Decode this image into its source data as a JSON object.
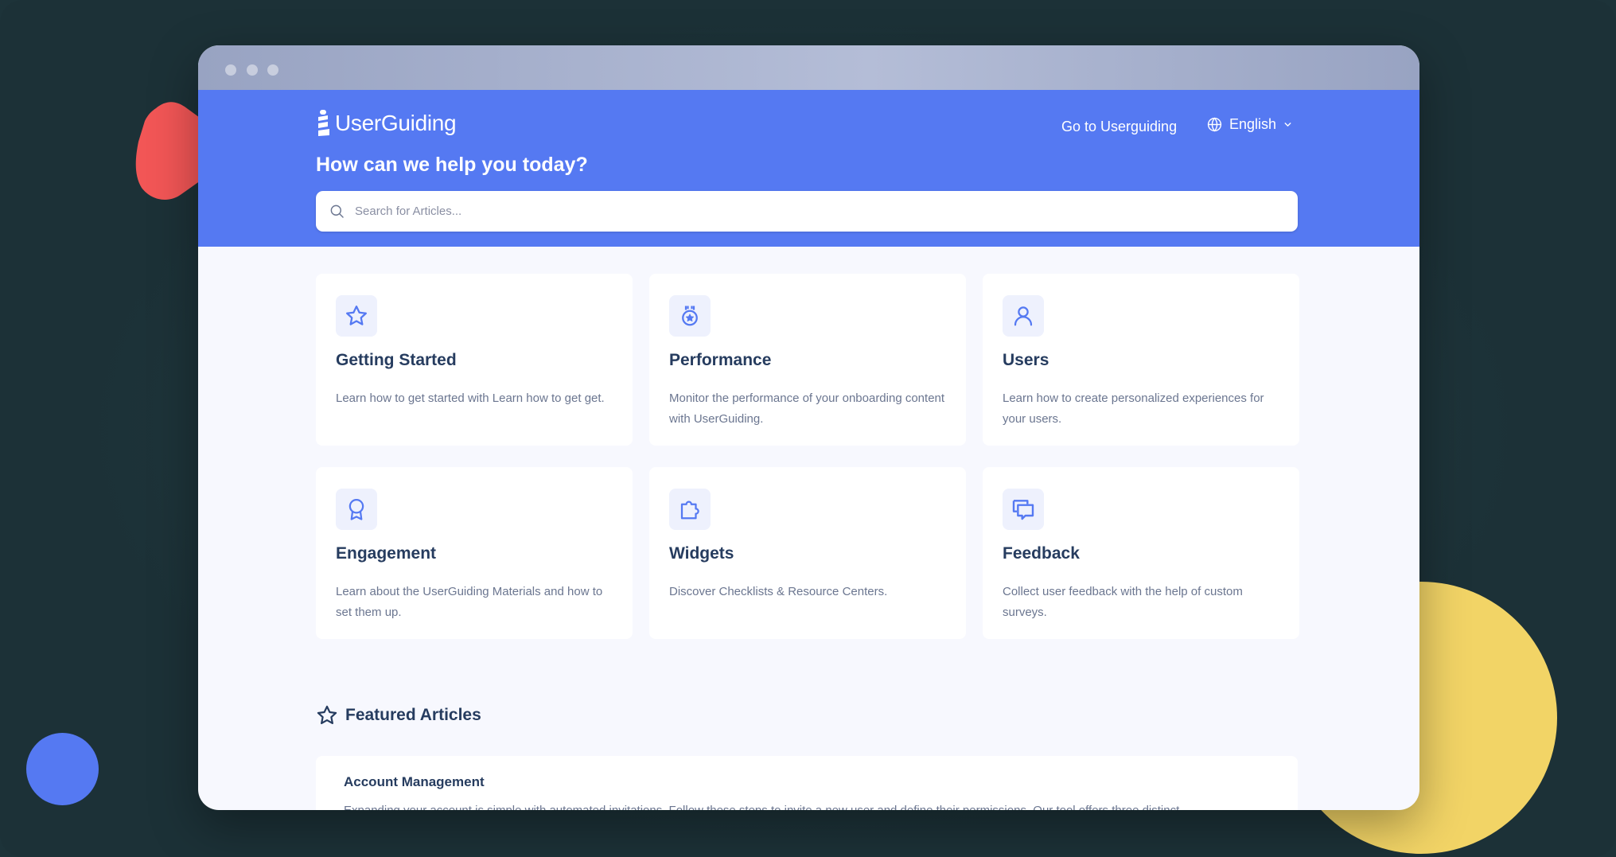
{
  "brand": {
    "logo_text": "UserGuiding",
    "primary_color": "#5579f2",
    "heading_color": "#263c5f"
  },
  "header": {
    "nav_link": "Go to Userguiding",
    "language": "English",
    "title": "How can we help you today?"
  },
  "search": {
    "placeholder": "Search for Articles..."
  },
  "categories": [
    {
      "icon": "star-icon",
      "title": "Getting Started",
      "description": "Learn how to get started with Learn how to get get."
    },
    {
      "icon": "medal-icon",
      "title": "Performance",
      "description": "Monitor the performance of your onboarding content with UserGuiding."
    },
    {
      "icon": "user-icon",
      "title": "Users",
      "description": "Learn how to create personalized experiences for your users."
    },
    {
      "icon": "award-ribbon-icon",
      "title": "Engagement",
      "description": "Learn about the UserGuiding Materials and how to set them up."
    },
    {
      "icon": "puzzle-icon",
      "title": "Widgets",
      "description": "Discover Checklists & Resource Centers."
    },
    {
      "icon": "chat-bubbles-icon",
      "title": "Feedback",
      "description": "Collect user feedback with the help of custom surveys."
    }
  ],
  "featured": {
    "heading": "Featured Articles",
    "articles": [
      {
        "title": "Account Management",
        "excerpt": "Expanding your account is simple with automated invitations. Follow these steps to invite a new user and define their permissions. Our tool offers three distinct"
      }
    ]
  }
}
